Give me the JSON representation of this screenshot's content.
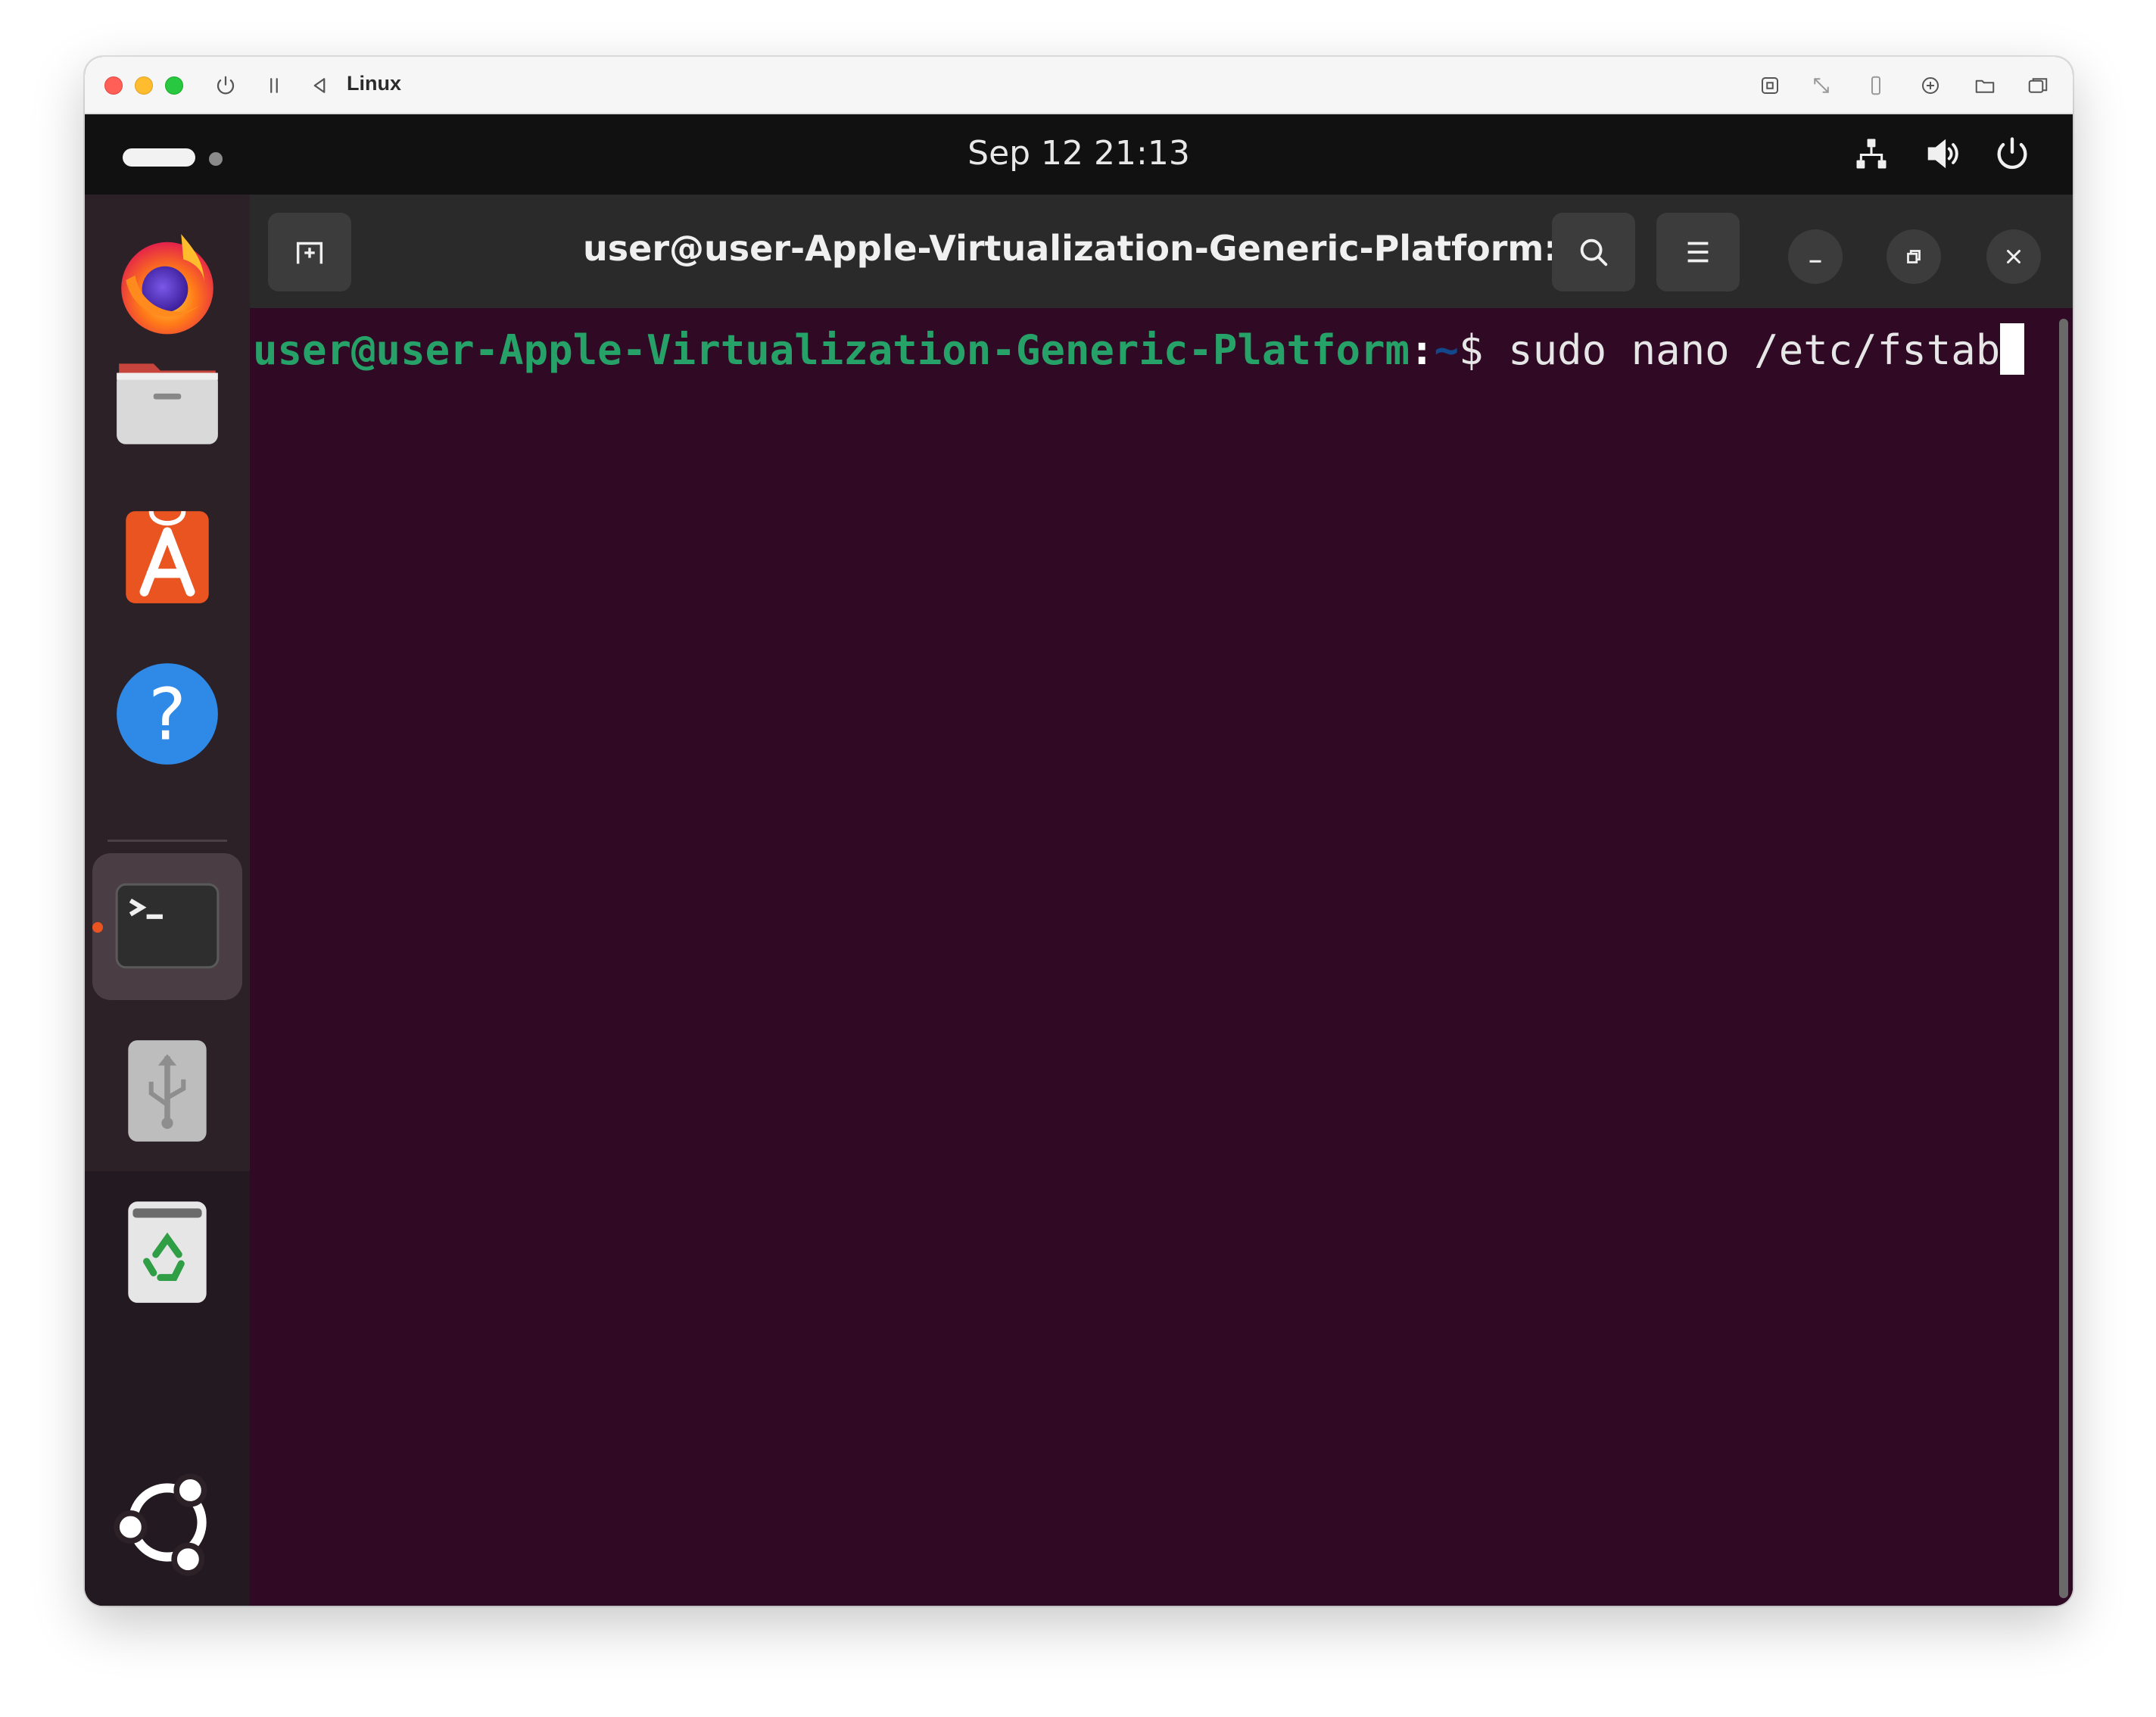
{
  "vm_window": {
    "title": "Linux"
  },
  "topbar": {
    "clock": "Sep 12  21:13"
  },
  "dock": {
    "apps": [
      {
        "name": "Firefox",
        "icon": "firefox-icon"
      },
      {
        "name": "Files",
        "icon": "files-icon"
      },
      {
        "name": "App Center",
        "icon": "app-center-icon"
      },
      {
        "name": "Help",
        "icon": "help-icon"
      },
      {
        "name": "Terminal",
        "icon": "terminal-icon",
        "running": true
      },
      {
        "name": "USB Drive",
        "icon": "usb-icon"
      },
      {
        "name": "Trash",
        "icon": "trash-icon"
      },
      {
        "name": "Show Apps",
        "icon": "ubuntu-logo-icon"
      }
    ]
  },
  "terminal": {
    "title": "user@user-Apple-Virtualization-Generic-Platform: ~",
    "prompt_user_host": "user@user-Apple-Virtualization-Generic-Platform",
    "prompt_colon": ":",
    "prompt_path": "~",
    "prompt_symbol": "$",
    "command": " sudo nano /etc/fstab"
  },
  "colors": {
    "terminal_bg": "#300a24",
    "prompt_green": "#26a269",
    "prompt_blue": "#12488b",
    "accent_orange": "#e95420"
  }
}
